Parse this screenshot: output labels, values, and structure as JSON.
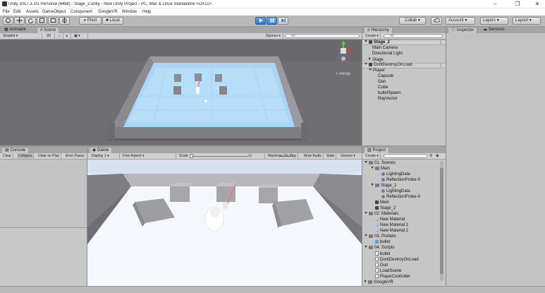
{
  "window": {
    "title": "Unity 2017.3.1f1 Personal (64bit) - Stage_2.unity - New Unity Project - PC, Mac & Linux Standalone <DX11>",
    "min_glyph": "–",
    "max_glyph": "❐",
    "close_glyph": "✕"
  },
  "menu": [
    "File",
    "Edit",
    "Assets",
    "GameObject",
    "Component",
    "GoogleVR",
    "Window",
    "Help"
  ],
  "toolbar": {
    "pivot": "Pivot",
    "local": "Local",
    "collab": "Collab ▾",
    "account": "Account",
    "layers": "Layers",
    "layout": "Layout"
  },
  "scene_panel": {
    "tabs": [
      "Animator",
      "Scene"
    ],
    "shading": "Shaded",
    "mode2d": "2D",
    "gizmos": "Gizmos ▾",
    "search_placeholder": "All",
    "persp": "< Persp"
  },
  "console_panel": {
    "tab": "Console",
    "buttons": [
      "Clear",
      "Collapse",
      "Clear on Play",
      "Error Pause"
    ]
  },
  "game_panel": {
    "tab": "Game",
    "display": "Display 1",
    "aspect": "Free Aspect",
    "scale_label": "Scale",
    "scale_value": "1x",
    "buttons": [
      "Maximize On Play",
      "Mute Audio",
      "Stats",
      "Gizmos ▾"
    ]
  },
  "hierarchy": {
    "tab": "Hierarchy",
    "create": "Create ▾",
    "search_placeholder": "All",
    "scene1": "Stage_2",
    "scene1_items": [
      "Main Camera",
      "Directional Light",
      "Stage"
    ],
    "scene2": "DontDestroyOnLoad",
    "player": "Player",
    "player_children": [
      "Capsule",
      "Gun",
      "Cube",
      "bulletSpawn",
      "RayVector"
    ]
  },
  "project": {
    "tab": "Project",
    "create": "Create ▾",
    "tree": [
      {
        "indent": 0,
        "icon": "folder",
        "open": true,
        "label": "01. Scenes"
      },
      {
        "indent": 1,
        "icon": "folder",
        "open": true,
        "label": "Main"
      },
      {
        "indent": 2,
        "icon": "asset",
        "label": "LightingData"
      },
      {
        "indent": 2,
        "icon": "asset",
        "label": "ReflectionProbe-0"
      },
      {
        "indent": 1,
        "icon": "folder",
        "open": true,
        "label": "Stage_2"
      },
      {
        "indent": 2,
        "icon": "asset",
        "label": "LightingData"
      },
      {
        "indent": 2,
        "icon": "asset",
        "label": "ReflectionProbe-0"
      },
      {
        "indent": 1,
        "icon": "unity",
        "label": "Main"
      },
      {
        "indent": 1,
        "icon": "unity",
        "label": "Stage_2"
      },
      {
        "indent": 0,
        "icon": "folder",
        "open": true,
        "label": "02. Materials"
      },
      {
        "indent": 1,
        "icon": "mat",
        "label": "New Material"
      },
      {
        "indent": 1,
        "icon": "mat",
        "label": "New Material 1"
      },
      {
        "indent": 1,
        "icon": "mat",
        "label": "New Material 2"
      },
      {
        "indent": 0,
        "icon": "folder",
        "open": true,
        "label": "03. Prefabs"
      },
      {
        "indent": 1,
        "icon": "prefab",
        "label": "bullet"
      },
      {
        "indent": 0,
        "icon": "folder",
        "open": true,
        "label": "04. Scripts"
      },
      {
        "indent": 1,
        "icon": "script",
        "label": "bullet"
      },
      {
        "indent": 1,
        "icon": "script",
        "label": "DontDestroyOnLoad"
      },
      {
        "indent": 1,
        "icon": "script",
        "label": "Gun"
      },
      {
        "indent": 1,
        "icon": "script",
        "label": "LoadScene"
      },
      {
        "indent": 1,
        "icon": "script",
        "label": "PlayerController"
      },
      {
        "indent": 0,
        "icon": "folder",
        "open": false,
        "label": "GoogleVR"
      }
    ]
  },
  "inspector": {
    "tabs": [
      "Inspector",
      "Services"
    ]
  },
  "colors": {
    "scene_sky": "#6f6f72",
    "floor_blue": "#a9d6f5",
    "wall_grey": "#8f8f95",
    "game_sky": "#d7e2ef",
    "play_blue": "#3a86d8"
  }
}
